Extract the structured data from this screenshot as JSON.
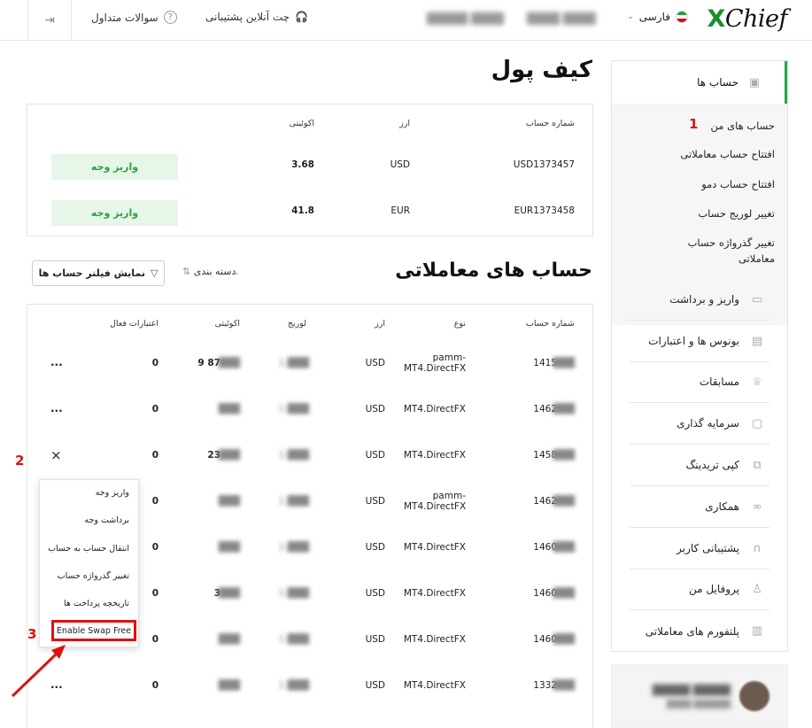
{
  "header": {
    "logo_text": "Chief",
    "logo_x": "X",
    "language": "فارسی",
    "support_chat": "چت آنلاین پشتیبانی",
    "faq": "سوالات متداول"
  },
  "sidebar": {
    "accounts": "حساب ها",
    "sub_items": [
      "حساب های من",
      "افتتاح حساب معاملاتی",
      "افتتاح حساب دمو",
      "تغییر لوریج حساب",
      "تغییر گذرواژه حساب معاملاتی"
    ],
    "items": [
      {
        "label": "واریز و برداشت",
        "icon": "wallet-icon"
      },
      {
        "label": "بونوس ها و اعتبارات",
        "icon": "bonus-icon"
      },
      {
        "label": "مسابقات",
        "icon": "trophy-icon"
      },
      {
        "label": "سرمایه گذاری",
        "icon": "briefcase-icon"
      },
      {
        "label": "کپی تریدینگ",
        "icon": "copy-icon"
      },
      {
        "label": "همکاری",
        "icon": "handshake-icon"
      },
      {
        "label": "پشتیبانی کاربر",
        "icon": "headset-icon"
      },
      {
        "label": "پروفایل من",
        "icon": "user-icon"
      },
      {
        "label": "پلتفورم های معاملاتی",
        "icon": "platform-icon"
      }
    ]
  },
  "wallet": {
    "title": "کیف پول",
    "headers": [
      "شماره حساب",
      "ارز",
      "اکوئیتی"
    ],
    "rows": [
      {
        "account": "USD1373457",
        "currency": "USD",
        "equity": "3.68",
        "button": "واریز وجه"
      },
      {
        "account": "EUR1373458",
        "currency": "EUR",
        "equity": "41.8",
        "button": "واریز وجه"
      }
    ]
  },
  "trading": {
    "title": "حساب های معاملاتی",
    "sort_label": "دسته بندی",
    "filter_label": "نمایش فیلتر حساب ها",
    "headers": [
      "شماره حساب",
      "نوع",
      "ارز",
      "لوریج",
      "اکوئیتی",
      "اعتبارات فعال"
    ],
    "rows": [
      {
        "account": "1415",
        "type": "pamm-MT4.DirectFX",
        "currency": "USD",
        "equity": "9 87",
        "credits": "0",
        "action": "..."
      },
      {
        "account": "1462",
        "type": "MT4.DirectFX",
        "currency": "USD",
        "equity": "",
        "credits": "0",
        "action": "..."
      },
      {
        "account": "1458",
        "type": "MT4.DirectFX",
        "currency": "USD",
        "equity": "23",
        "credits": "0",
        "action": "×"
      },
      {
        "account": "1462",
        "type": "pamm-MT4.DirectFX",
        "currency": "USD",
        "equity": "",
        "credits": "0",
        "action": ""
      },
      {
        "account": "1460",
        "type": "MT4.DirectFX",
        "currency": "USD",
        "equity": "",
        "credits": "0",
        "action": ""
      },
      {
        "account": "1460",
        "type": "MT4.DirectFX",
        "currency": "USD",
        "equity": "3",
        "credits": "0",
        "action": ""
      },
      {
        "account": "1460",
        "type": "MT4.DirectFX",
        "currency": "USD",
        "equity": "",
        "credits": "0",
        "action": ""
      },
      {
        "account": "1332",
        "type": "MT4.DirectFX",
        "currency": "USD",
        "equity": "",
        "credits": "0",
        "action": "..."
      }
    ]
  },
  "menu": {
    "items": [
      "واریز وجه",
      "برداشت وجه",
      "انتقال حساب به حساب",
      "تغییر گذرواژه حساب",
      "تاریخچه پرداخت ها"
    ],
    "swap": "Enable Swap Free"
  },
  "annotations": [
    "1",
    "2",
    "3"
  ],
  "colors": {
    "accent": "#27a745",
    "annotation": "#e01010"
  }
}
